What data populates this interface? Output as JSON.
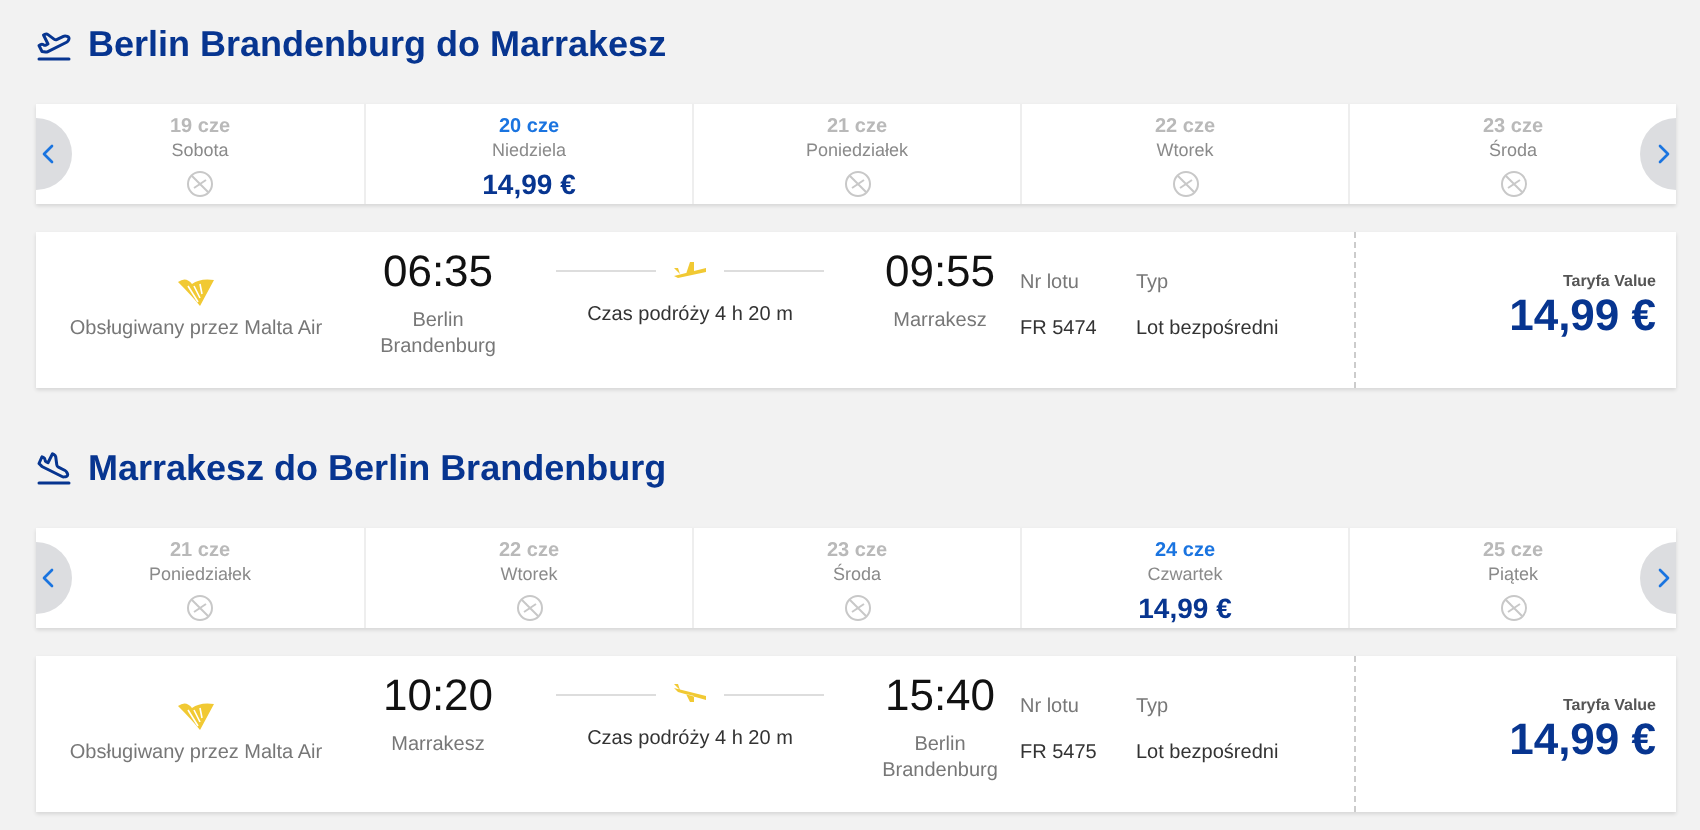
{
  "sections": [
    {
      "kind": "outbound",
      "title": "Berlin Brandenburg do Marrakesz",
      "dates": [
        {
          "date": "19 cze",
          "day": "Sobota",
          "selected": false
        },
        {
          "date": "20 cze",
          "day": "Niedziela",
          "price": "14,99 €",
          "selected": true
        },
        {
          "date": "21 cze",
          "day": "Poniedziałek",
          "selected": false
        },
        {
          "date": "22 cze",
          "day": "Wtorek",
          "selected": false
        },
        {
          "date": "23 cze",
          "day": "Środa",
          "selected": false
        }
      ],
      "flight": {
        "operator": "Obsługiwany przez Malta Air",
        "dep_time": "06:35",
        "dep_city": "Berlin Brandenburg",
        "duration": "Czas podróży 4 h 20 m",
        "arr_time": "09:55",
        "arr_city": "Marrakesz",
        "number_label": "Nr lotu",
        "number": "FR 5474",
        "type_label": "Typ",
        "type": "Lot bezpośredni",
        "fare_label": "Taryfa Value",
        "fare": "14,99 €"
      }
    },
    {
      "kind": "inbound",
      "title": "Marrakesz do Berlin Brandenburg",
      "dates": [
        {
          "date": "21 cze",
          "day": "Poniedziałek",
          "selected": false
        },
        {
          "date": "22 cze",
          "day": "Wtorek",
          "selected": false
        },
        {
          "date": "23 cze",
          "day": "Środa",
          "selected": false
        },
        {
          "date": "24 cze",
          "day": "Czwartek",
          "price": "14,99 €",
          "selected": true
        },
        {
          "date": "25 cze",
          "day": "Piątek",
          "selected": false
        }
      ],
      "flight": {
        "operator": "Obsługiwany przez Malta Air",
        "dep_time": "10:20",
        "dep_city": "Marrakesz",
        "duration": "Czas podróży 4 h 20 m",
        "arr_time": "15:40",
        "arr_city": "Berlin Brandenburg",
        "number_label": "Nr lotu",
        "number": "FR 5475",
        "type_label": "Typ",
        "type": "Lot bezpośredni",
        "fare_label": "Taryfa Value",
        "fare": "14,99 €"
      }
    }
  ]
}
